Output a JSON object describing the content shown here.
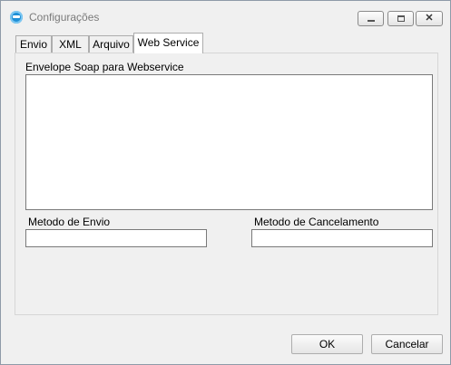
{
  "window": {
    "title": "Configurações",
    "app_icon": "soap-app-icon",
    "controls": [
      "minimize-icon",
      "maximize-icon",
      "close-icon"
    ]
  },
  "tabs": [
    {
      "label": "Envio",
      "active": false
    },
    {
      "label": "XML",
      "active": false
    },
    {
      "label": "Arquivo",
      "active": false
    },
    {
      "label": "Web Service",
      "active": true
    }
  ],
  "web_service": {
    "envelope_label": "Envelope Soap para Webservice",
    "envelope_value": "",
    "metodo_envio_label": "Metodo de Envio",
    "metodo_envio_value": "",
    "metodo_cancelamento_label": "Metodo de Cancelamento",
    "metodo_cancelamento_value": ""
  },
  "buttons": {
    "ok": "OK",
    "cancel": "Cancelar"
  }
}
